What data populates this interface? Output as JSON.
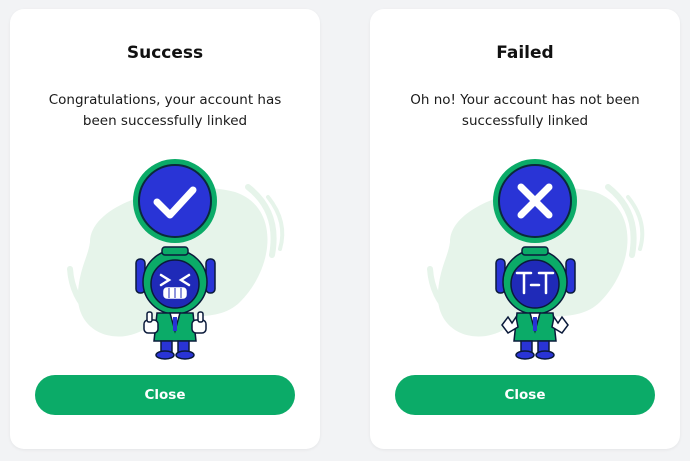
{
  "cards": {
    "success": {
      "title": "Success",
      "message": "Congratulations, your account has been successfully linked",
      "close_label": "Close"
    },
    "failed": {
      "title": "Failed",
      "message": "Oh no! Your account has not been successfully linked",
      "close_label": "Close"
    }
  },
  "icons": {
    "success_badge": "checkmark-icon",
    "failed_badge": "cross-icon",
    "success_robot": "robot-mascot-happy",
    "failed_robot": "robot-mascot-crying"
  },
  "colors": {
    "brand_green": "#0bab68",
    "badge_blue": "#2934d6",
    "blob_green": "#e6f4ea"
  }
}
